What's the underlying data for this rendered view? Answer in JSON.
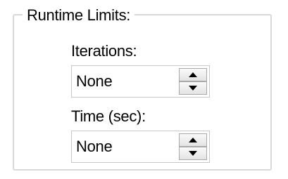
{
  "group": {
    "title": "Runtime Limits:"
  },
  "iterations": {
    "label": "Iterations:",
    "value": "None",
    "increment_icon": "triangle-up",
    "decrement_icon": "triangle-down"
  },
  "time": {
    "label": "Time (sec):",
    "value": "None",
    "increment_icon": "triangle-up",
    "decrement_icon": "triangle-down"
  },
  "colors": {
    "group_border": "#d9d9d9",
    "field_border": "#c7c7c7",
    "button_border": "#a9a9a9"
  }
}
